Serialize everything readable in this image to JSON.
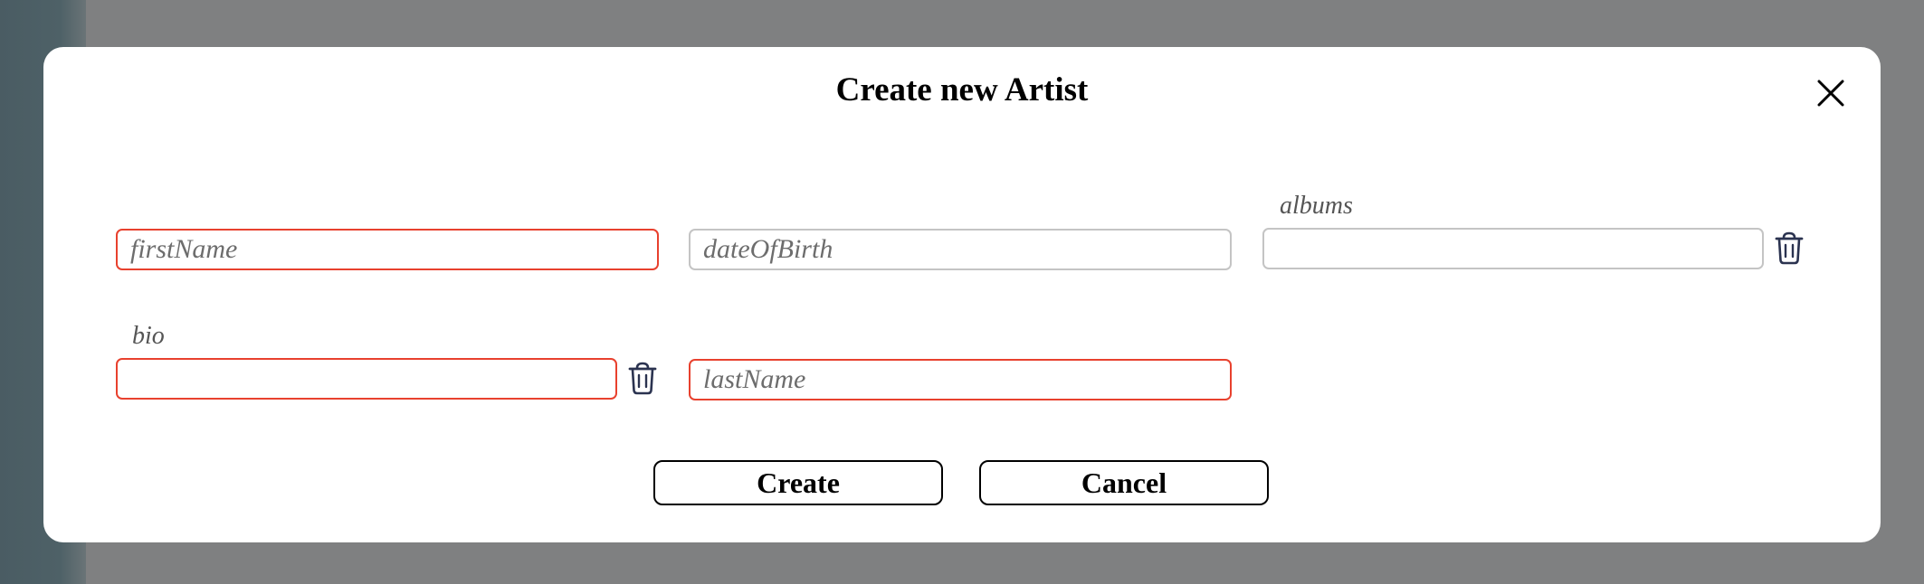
{
  "dialog": {
    "title": "Create new Artist"
  },
  "fields": {
    "firstName": {
      "value": "",
      "placeholder": "firstName"
    },
    "dateOfBirth": {
      "value": "",
      "placeholder": "dateOfBirth"
    },
    "albums": {
      "label": "albums",
      "value": ""
    },
    "bio": {
      "label": "bio",
      "value": ""
    },
    "lastName": {
      "value": "",
      "placeholder": "lastName"
    }
  },
  "actions": {
    "create_label": "Create",
    "cancel_label": "Cancel"
  },
  "icons": {
    "close": "close-icon",
    "trash": "trash-icon"
  },
  "colors": {
    "invalid_border": "#e8412e",
    "default_border": "#c4c4c4",
    "icon_color": "#2b3350"
  }
}
